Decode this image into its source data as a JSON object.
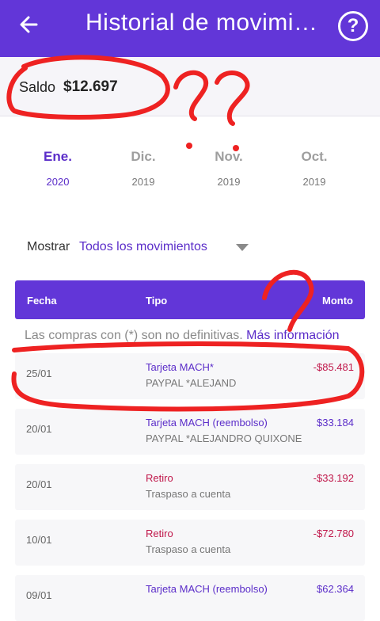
{
  "header": {
    "title": "Historial de movimientos",
    "back_icon": "arrow-left-icon",
    "help_icon": "help-circle-icon",
    "help_symbol": "?"
  },
  "balance": {
    "label": "Saldo",
    "value": "$12.697"
  },
  "months": [
    {
      "month": "Ene.",
      "year": "2020",
      "active": true
    },
    {
      "month": "Dic.",
      "year": "2019",
      "active": false
    },
    {
      "month": "Nov.",
      "year": "2019",
      "active": false
    },
    {
      "month": "Oct.",
      "year": "2019",
      "active": false
    }
  ],
  "filter": {
    "label": "Mostrar",
    "value": "Todos los movimientos"
  },
  "table": {
    "headers": {
      "date": "Fecha",
      "type": "Tipo",
      "amount": "Monto"
    },
    "notice_text": "Las compras con (*) son no definitivas.",
    "notice_link": "Más información",
    "rows": [
      {
        "date": "25/01",
        "type": "Tarjeta MACH*",
        "description": "PAYPAL *ALEJAND",
        "amount": "-$85.481"
      },
      {
        "date": "20/01",
        "type": "Tarjeta MACH (reembolso)",
        "description": "PAYPAL *ALEJANDRO QUIXONE",
        "amount": "$33.184"
      },
      {
        "date": "20/01",
        "type": "Retiro",
        "description": "Traspaso a cuenta",
        "amount": "-$33.192"
      },
      {
        "date": "10/01",
        "type": "Retiro",
        "description": "Traspaso a cuenta",
        "amount": "-$72.780"
      },
      {
        "date": "09/01",
        "type": "Tarjeta MACH (reembolso)",
        "description": "",
        "amount": "$62.364"
      }
    ]
  },
  "colors": {
    "primary": "#6236d8",
    "negative": "#c0174a",
    "annotation": "#ee2222"
  }
}
